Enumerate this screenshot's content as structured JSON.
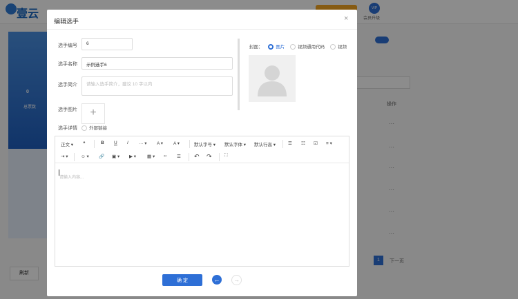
{
  "background": {
    "logo_text": "壹云",
    "vip_label": "会员升级",
    "vip_badge": "VIP",
    "left_poster_count": "0",
    "left_stat_label": "总票数",
    "right_col_header": "操作",
    "pager_current": "1",
    "pager_next": "下一页",
    "left_footer": "刷新"
  },
  "modal": {
    "title": "编辑选手",
    "close_glyph": "×",
    "fields": {
      "number_label": "选手编号",
      "number_value": "6",
      "name_label": "选手名称",
      "name_value": "示例选手6",
      "intro_label": "选手简介",
      "intro_placeholder": "请输入选手简介，建议 10 字以内",
      "image_label": "选手图片",
      "detail_label": "选手详情",
      "external_link_label": "外部链接"
    },
    "cover": {
      "label": "封面：",
      "options": [
        "图片",
        "视频通用代码",
        "视频"
      ],
      "selected": "图片"
    },
    "editor": {
      "toolbar": {
        "paragraph": "正文",
        "quote": "❝",
        "bold": "B",
        "underline": "U",
        "italic": "I",
        "more": "···",
        "font_color": "A",
        "bg_color": "A",
        "font_size": "默认字号",
        "font_family": "默认字体",
        "line_height": "默认行高",
        "bullet_list": "☰",
        "ordered_list": "☷",
        "todo": "☑",
        "align": "≡",
        "indent": "⇥",
        "emoji": "☺",
        "link": "🔗",
        "image": "▣",
        "video": "▶",
        "table": "▦",
        "code": "‹›",
        "divider": "☰",
        "undo": "↶",
        "redo": "↷",
        "fullscreen": "⛶"
      },
      "placeholder": "请输入内容..."
    },
    "confirm_label": "确 定",
    "prev_glyph": "←",
    "next_glyph": "→"
  },
  "colors": {
    "accent": "#2e6fd6",
    "overlay": "rgba(0,0,0,0.45)"
  }
}
